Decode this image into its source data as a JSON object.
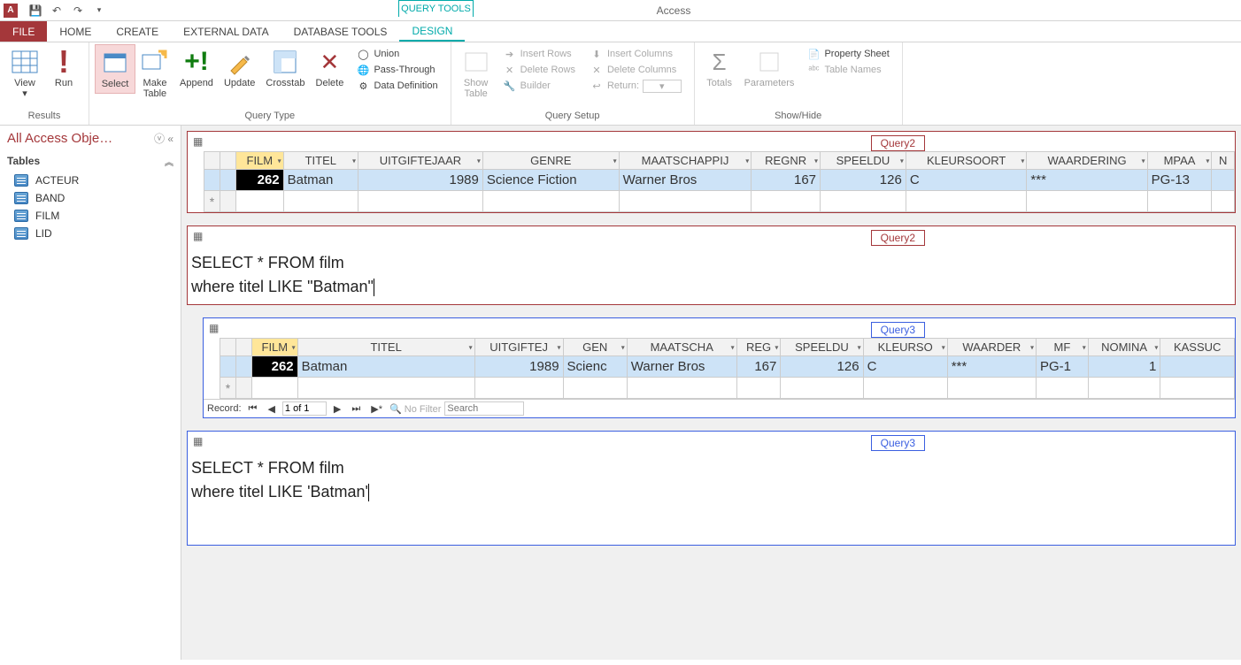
{
  "app": {
    "title": "Access",
    "tool_tab": "QUERY TOOLS"
  },
  "qat": {
    "undo": "↶",
    "redo": "↷"
  },
  "tabs": {
    "file": "FILE",
    "home": "HOME",
    "create": "CREATE",
    "external": "EXTERNAL DATA",
    "dbtools": "DATABASE TOOLS",
    "design": "DESIGN"
  },
  "ribbon": {
    "results": {
      "label": "Results",
      "view": "View",
      "run": "Run"
    },
    "querytype": {
      "label": "Query Type",
      "select": "Select",
      "make": "Make\nTable",
      "append": "Append",
      "update": "Update",
      "crosstab": "Crosstab",
      "delete": "Delete",
      "union": "Union",
      "pass": "Pass-Through",
      "datadef": "Data Definition"
    },
    "setup": {
      "label": "Query Setup",
      "showtable": "Show\nTable",
      "insertrows": "Insert Rows",
      "deleterows": "Delete Rows",
      "builder": "Builder",
      "insertcols": "Insert Columns",
      "deletecols": "Delete Columns",
      "return": "Return:"
    },
    "showhide": {
      "label": "Show/Hide",
      "totals": "Totals",
      "params": "Parameters",
      "propsheet": "Property Sheet",
      "tablenames": "Table Names"
    }
  },
  "nav": {
    "title": "All Access Obje…",
    "group": "Tables",
    "items": [
      "ACTEUR",
      "BAND",
      "FILM",
      "LID"
    ]
  },
  "q2": {
    "tag": "Query2",
    "cols": [
      "FILM",
      "TITEL",
      "UITGIFTEJAAR",
      "GENRE",
      "MAATSCHAPPIJ",
      "REGNR",
      "SPEELDU",
      "KLEURSOORT",
      "WAARDERING",
      "MPAA",
      "N"
    ],
    "row": {
      "film": "262",
      "titel": "Batman",
      "jaar": "1989",
      "genre": "Science Fiction",
      "maat": "Warner Bros",
      "reg": "167",
      "speel": "126",
      "kleur": "C",
      "waard": "***",
      "mpaa": "PG-13"
    },
    "sql": "SELECT * FROM film\nwhere titel LIKE \"Batman\""
  },
  "q3": {
    "tag": "Query3",
    "cols": [
      "FILM",
      "TITEL",
      "UITGIFTEJ",
      "GEN",
      "MAATSCHA",
      "REG",
      "SPEELDU",
      "KLEURSO",
      "WAARDER",
      "MF",
      "NOMINA",
      "KASSUC"
    ],
    "row": {
      "film": "262",
      "titel": "Batman",
      "jaar": "1989",
      "genre": "Scienc",
      "maat": "Warner Bros",
      "reg": "167",
      "speel": "126",
      "kleur": "C",
      "waard": "***",
      "mpaa": "PG-1",
      "nom": "1"
    },
    "recnav": {
      "label": "Record:",
      "pos": "1 of 1",
      "nofilter": "No Filter",
      "search": "Search"
    },
    "sql": "SELECT * FROM film\nwhere titel LIKE 'Batman'"
  }
}
